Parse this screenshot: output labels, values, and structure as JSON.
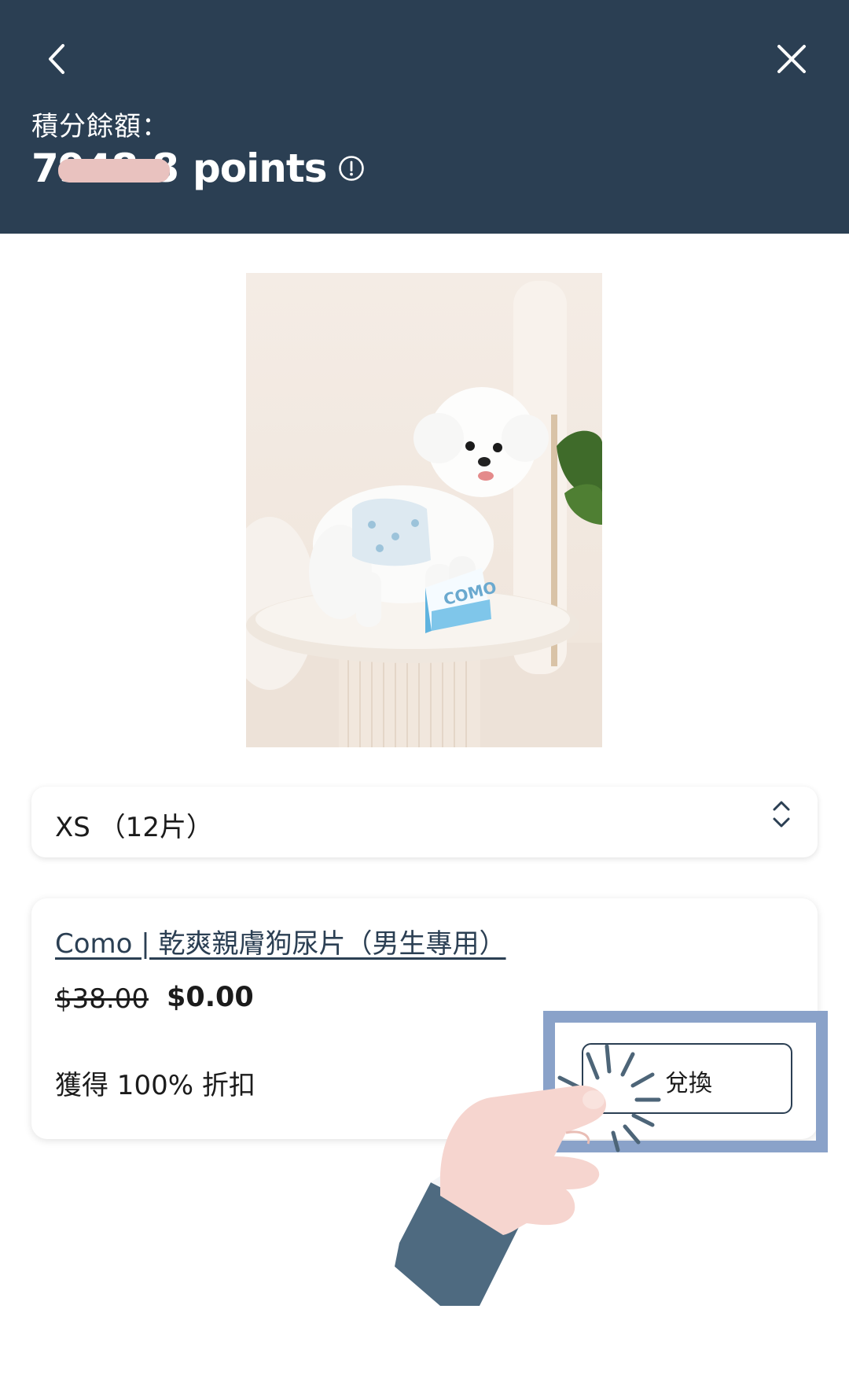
{
  "header": {
    "balance_label": "積分餘額：",
    "balance_value": "7948.8",
    "balance_unit": "points"
  },
  "colors": {
    "header_bg": "#2b3f53",
    "highlight": "#8aa2c9",
    "redact": "#e9c2bf"
  },
  "size_select": {
    "value": "XS （12片）"
  },
  "product": {
    "title": "Como | 乾爽親膚狗尿片（男生專用）",
    "original_price": "$38.00",
    "sale_price": "$0.00",
    "discount": "獲得 100% 折扣",
    "redeem_label": "兌換"
  },
  "icons": {
    "back": "chevron-left-icon",
    "close": "close-icon",
    "info": "info-icon",
    "select": "chevron-updown-icon"
  }
}
